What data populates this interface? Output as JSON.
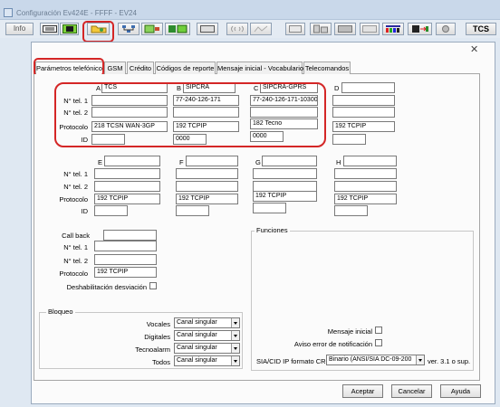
{
  "window": {
    "title": "Configuración Ev424E - FFFF - EV24"
  },
  "toolbar": {
    "info_label": "Info",
    "tcs_label": "TCS"
  },
  "tabs": [
    "Parámetros telefónicos",
    "GSM",
    "Crédito",
    "Códigos de reporte",
    "Mensaje inicial - Vocabulario",
    "Telecomandos"
  ],
  "row_labels": {
    "tel1": "N° tel. 1",
    "tel2": "N° tel. 2",
    "protocolo": "Protocolo",
    "id": "ID"
  },
  "slots_top": [
    {
      "letter": "A",
      "name": "TCS",
      "tel1": "",
      "tel2": "",
      "protocolo": "218 TCSN WAN-3GP",
      "id": ""
    },
    {
      "letter": "B",
      "name": "SIPCRA",
      "tel1": "77-240-126-171",
      "tel2": "",
      "protocolo": "192 TCPIP",
      "id": "0000"
    },
    {
      "letter": "C",
      "name": "SIPCRA-GPRS",
      "tel1": "77-240-126-171-10300",
      "tel2": "",
      "protocolo": "182 Tecno",
      "id": "0000"
    },
    {
      "letter": "D",
      "name": "",
      "tel1": "",
      "tel2": "",
      "protocolo": "192 TCPIP",
      "id": ""
    }
  ],
  "slots_bottom": [
    {
      "letter": "E",
      "name": "",
      "tel1": "",
      "tel2": "",
      "protocolo": "192 TCPIP",
      "id": ""
    },
    {
      "letter": "F",
      "name": "",
      "tel1": "",
      "tel2": "",
      "protocolo": "192 TCPIP",
      "id": ""
    },
    {
      "letter": "G",
      "name": "",
      "tel1": "",
      "tel2": "",
      "protocolo": "192 TCPIP",
      "id": ""
    },
    {
      "letter": "H",
      "name": "",
      "tel1": "",
      "tel2": "",
      "protocolo": "192 TCPIP",
      "id": ""
    }
  ],
  "callback": {
    "label": "Call back",
    "tel1_label": "N° tel. 1",
    "tel2_label": "N° tel. 2",
    "protocolo_label": "Protocolo",
    "protocolo_value": "192 TCPIP",
    "deshab_label": "Deshabilitación desviación"
  },
  "bloqueo": {
    "title": "Bloqueo",
    "rows": [
      {
        "label": "Vocales",
        "value": "Canal singular"
      },
      {
        "label": "Digitales",
        "value": "Canal singular"
      },
      {
        "label": "Tecnoalarm",
        "value": "Canal singular"
      },
      {
        "label": "Todos",
        "value": "Canal singular"
      }
    ]
  },
  "funciones": {
    "title": "Funciones",
    "mensaje_inicial": "Mensaje inicial",
    "aviso_error": "Aviso error de notificación",
    "sia_label": "SIA/CID IP formato CRC",
    "sia_value": "Binario (ANSI/SIA DC-09-200",
    "sia_version": "ver. 3.1 o sup."
  },
  "buttons": {
    "accept": "Aceptar",
    "cancel": "Cancelar",
    "help": "Ayuda"
  },
  "colors": {
    "highlight": "#d42626"
  }
}
